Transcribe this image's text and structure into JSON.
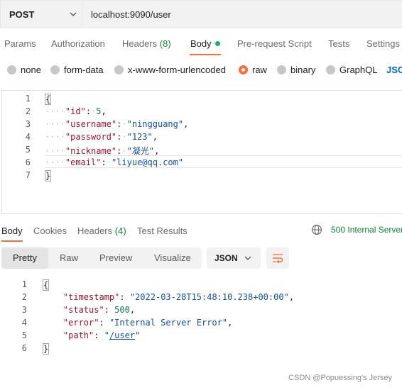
{
  "request": {
    "method": "POST",
    "url": "localhost:9090/user"
  },
  "request_tabs": [
    {
      "label": "Params"
    },
    {
      "label": "Authorization"
    },
    {
      "label": "Headers",
      "count": "(8)"
    },
    {
      "label": "Body"
    },
    {
      "label": "Pre-request Script"
    },
    {
      "label": "Tests"
    },
    {
      "label": "Settings"
    }
  ],
  "body_types": [
    {
      "label": "none",
      "selected": false
    },
    {
      "label": "form-data",
      "selected": false
    },
    {
      "label": "x-www-form-urlencoded",
      "selected": false
    },
    {
      "label": "raw",
      "selected": true
    },
    {
      "label": "binary",
      "selected": false
    },
    {
      "label": "GraphQL",
      "selected": false
    },
    {
      "label": "JSC",
      "selected": false
    }
  ],
  "request_body": {
    "line_numbers": [
      "1",
      "2",
      "3",
      "4",
      "5",
      "6",
      "7"
    ],
    "open_brace": "{",
    "close_brace": "}",
    "fields": [
      {
        "key": "\"id\"",
        "value": "5",
        "type": "number",
        "comma": ","
      },
      {
        "key": "\"username\"",
        "value": "\"ningguang\"",
        "type": "string",
        "comma": ","
      },
      {
        "key": "\"password\"",
        "value": "\"123\"",
        "type": "string",
        "comma": ","
      },
      {
        "key": "\"nickname\"",
        "value": "\"凝光\"",
        "type": "string",
        "comma": ","
      },
      {
        "key": "\"email\"",
        "value": "\"liyue@qq.com\"",
        "type": "string",
        "comma": ""
      }
    ]
  },
  "response_tabs": [
    {
      "label": "Body"
    },
    {
      "label": "Cookies"
    },
    {
      "label": "Headers",
      "count": "(4)"
    },
    {
      "label": "Test Results"
    }
  ],
  "response_status": "500 Internal Server",
  "view_modes": [
    "Pretty",
    "Raw",
    "Preview",
    "Visualize"
  ],
  "format": "JSON",
  "response_body": {
    "line_numbers": [
      "1",
      "2",
      "3",
      "4",
      "5",
      "6"
    ],
    "open_brace": "{",
    "close_brace": "}",
    "fields": [
      {
        "key": "\"timestamp\"",
        "value": "\"2022-03-28T15:48:10.238+00:00\"",
        "type": "string",
        "comma": ","
      },
      {
        "key": "\"status\"",
        "value": "500",
        "type": "number",
        "comma": ","
      },
      {
        "key": "\"error\"",
        "value": "\"Internal Server Error\"",
        "type": "string",
        "comma": ","
      },
      {
        "key": "\"path\"",
        "value_prefix": "\"",
        "value_link": "/user",
        "value_suffix": "\"",
        "type": "string",
        "comma": ""
      }
    ]
  },
  "watermark": "CSDN @Popuessing's Jersey",
  "colors": {
    "accent": "#ff6c37",
    "success_dot": "#0cbb52",
    "status_error": "#0b8a3a",
    "json_key": "#a0142b",
    "json_string": "#0f4f9e",
    "json_number": "#0a7a4f"
  },
  "icons": [
    "chevron-down-icon",
    "globe-icon",
    "wrap-lines-icon"
  ]
}
